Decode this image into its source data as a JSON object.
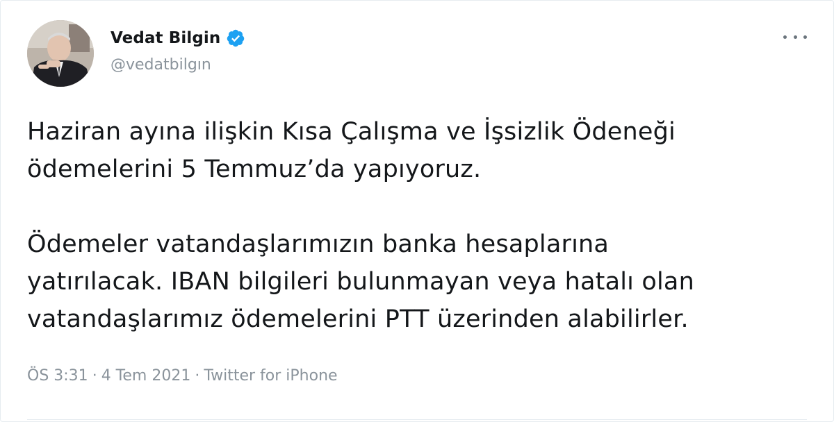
{
  "user": {
    "display_name": "Vedat Bilgin",
    "handle": "@vedatbilgın",
    "verified": true
  },
  "tweet": {
    "paragraphs": [
      [
        "Haziran ayına ilişkin Kısa Çalışma ve İşsizlik Ödeneği",
        "ödemelerini 5 Temmuz’da yapıyoruz."
      ],
      [
        "Ödemeler vatandaşlarımızın banka hesaplarına",
        "yatırılacak. IBAN bilgileri bulunmayan veya hatalı olan",
        "vatandaşlarımız ödemelerini PTT üzerinden alabilirler."
      ]
    ]
  },
  "meta": {
    "time": "ÖS 3:31",
    "date": "4 Tem 2021",
    "source": "Twitter for iPhone",
    "separator": "·"
  },
  "icons": {
    "verified": "verified-badge-icon",
    "more": "more-horizontal-icon"
  },
  "colors": {
    "verified_blue": "#1da1f2",
    "secondary_text": "#8a939b",
    "primary_text": "#14171a"
  }
}
